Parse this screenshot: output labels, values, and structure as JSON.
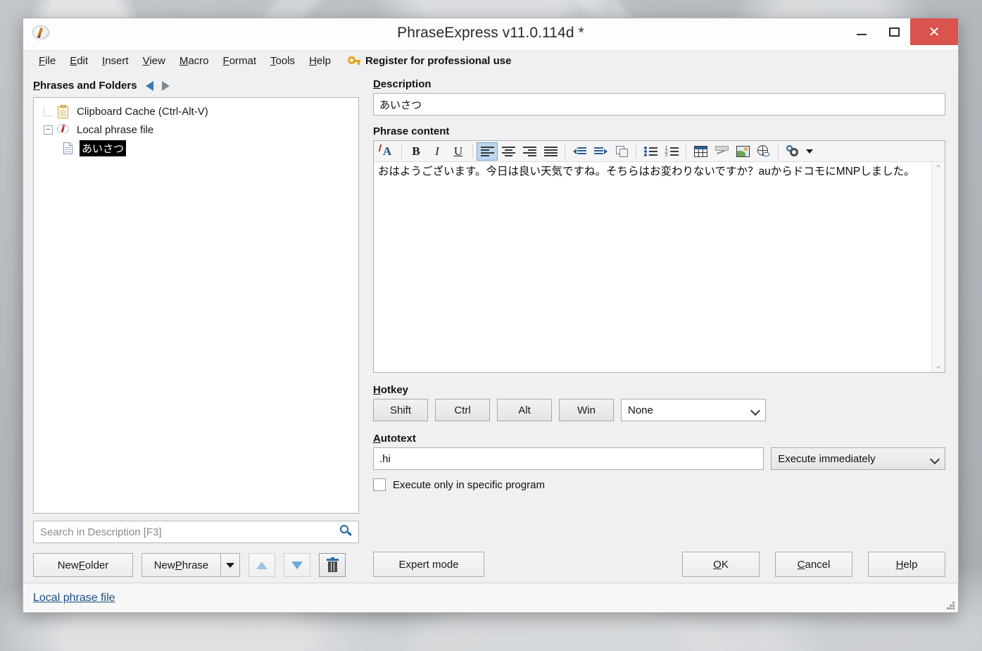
{
  "window": {
    "title": "PhraseExpress v11.0.114d *",
    "app_icon": "speech-bubble-pen-icon",
    "minimize_label": "Minimize",
    "maximize_label": "Maximize",
    "close_label": "✕"
  },
  "menubar": {
    "items": [
      {
        "label": "File",
        "accel": "F"
      },
      {
        "label": "Edit",
        "accel": "E"
      },
      {
        "label": "Insert",
        "accel": "I"
      },
      {
        "label": "View",
        "accel": "V"
      },
      {
        "label": "Macro",
        "accel": "M"
      },
      {
        "label": "Format",
        "accel": "F"
      },
      {
        "label": "Tools",
        "accel": "T"
      },
      {
        "label": "Help",
        "accel": "H"
      }
    ],
    "register_label": "Register for professional use",
    "register_icon": "key-icon"
  },
  "left_pane": {
    "header": "Phrases and Folders",
    "nav_back_icon": "arrow-left-icon",
    "nav_forward_icon": "arrow-right-icon",
    "tree": [
      {
        "label": "Clipboard Cache (Ctrl-Alt-V)",
        "icon": "clipboard-icon",
        "level": 1,
        "selected": false,
        "expander": null
      },
      {
        "label": "Local phrase file",
        "icon": "phrase-file-icon",
        "level": 1,
        "selected": false,
        "expander": "-"
      },
      {
        "label": "あいさつ",
        "icon": "document-icon",
        "level": 2,
        "selected": true,
        "expander": null
      }
    ],
    "search": {
      "placeholder": "Search in Description [F3]",
      "value": "",
      "icon": "search-icon"
    },
    "buttons": {
      "new_folder": "New Folder",
      "new_folder_accel": "F",
      "new_phrase": "New Phrase",
      "new_phrase_accel": "P",
      "dropdown_icon": "chevron-down-icon",
      "move_up_icon": "arrow-up-icon",
      "move_down_icon": "arrow-down-icon",
      "delete_icon": "trash-icon"
    }
  },
  "right_pane": {
    "description": {
      "label": "Description",
      "accel": "D",
      "value": "あいさつ"
    },
    "phrase_content": {
      "label": "Phrase content",
      "text": "おはようございます。今日は良い天気ですね。そちらはお変わりないですか？auからドコモにMNPしました。",
      "toolbar": [
        {
          "name": "font-color-icon",
          "glyph": "A"
        },
        {
          "name": "bold-icon",
          "glyph": "B"
        },
        {
          "name": "italic-icon",
          "glyph": "I"
        },
        {
          "name": "underline-icon",
          "glyph": "U"
        },
        {
          "name": "align-left-icon",
          "glyph": ""
        },
        {
          "name": "align-center-icon",
          "glyph": ""
        },
        {
          "name": "align-right-icon",
          "glyph": ""
        },
        {
          "name": "align-justify-icon",
          "glyph": ""
        },
        {
          "name": "decrease-indent-icon",
          "glyph": ""
        },
        {
          "name": "increase-indent-icon",
          "glyph": ""
        },
        {
          "name": "paste-special-icon",
          "glyph": ""
        },
        {
          "name": "bullet-list-icon",
          "glyph": ""
        },
        {
          "name": "numbered-list-icon",
          "glyph": ""
        },
        {
          "name": "insert-table-icon",
          "glyph": ""
        },
        {
          "name": "insert-drawing-icon",
          "glyph": ""
        },
        {
          "name": "insert-image-icon",
          "glyph": ""
        },
        {
          "name": "insert-hyperlink-icon",
          "glyph": ""
        },
        {
          "name": "settings-gear-icon",
          "glyph": ""
        }
      ],
      "scroll_up_icon": "chevron-up-icon",
      "scroll_down_icon": "chevron-down-icon"
    },
    "hotkey": {
      "label": "Hotkey",
      "accel": "H",
      "modifiers": [
        "Shift",
        "Ctrl",
        "Alt",
        "Win"
      ],
      "key_value": "None"
    },
    "autotext": {
      "label": "Autotext",
      "accel": "A",
      "value": ".hi",
      "mode_value": "Execute immediately",
      "checkbox_label": "Execute only in specific program",
      "checkbox_checked": false
    },
    "footer": {
      "expert_mode": "Expert mode",
      "ok": "OK",
      "ok_accel": "O",
      "cancel": "Cancel",
      "cancel_accel": "C",
      "help": "Help",
      "help_accel": "H"
    }
  },
  "statusbar": {
    "link": "Local phrase file",
    "resize_grip_icon": "resize-grip-icon"
  },
  "colors": {
    "accent_blue": "#1f5fa8",
    "close_red": "#d9534f",
    "key_gold": "#e8a317",
    "selection_black": "#000000",
    "link_blue": "#1c4f86"
  }
}
